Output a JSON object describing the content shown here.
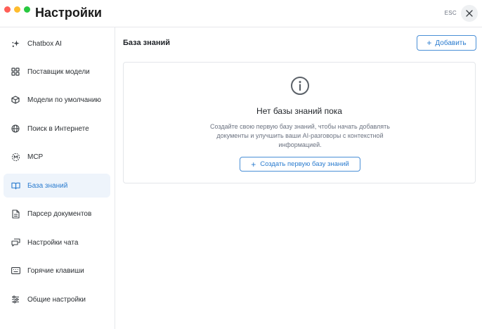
{
  "window": {
    "title": "Настройки",
    "esc_label": "ESC"
  },
  "sidebar": {
    "items": [
      {
        "label": "Chatbox AI",
        "icon": "sparkle-icon",
        "active": false
      },
      {
        "label": "Поставщик модели",
        "icon": "grid-icon",
        "active": false
      },
      {
        "label": "Модели по умолчанию",
        "icon": "cube-icon",
        "active": false
      },
      {
        "label": "Поиск в Интернете",
        "icon": "globe-icon",
        "active": false
      },
      {
        "label": "MCP",
        "icon": "mcp-icon",
        "active": false
      },
      {
        "label": "База знаний",
        "icon": "book-icon",
        "active": true
      },
      {
        "label": "Парсер документов",
        "icon": "document-icon",
        "active": false
      },
      {
        "label": "Настройки чата",
        "icon": "chat-icon",
        "active": false
      },
      {
        "label": "Горячие клавиши",
        "icon": "keyboard-icon",
        "active": false
      },
      {
        "label": "Общие настройки",
        "icon": "sliders-icon",
        "active": false
      }
    ]
  },
  "main": {
    "title": "База знаний",
    "add_label": "Добавить",
    "empty_state": {
      "icon": "info-icon",
      "title": "Нет базы знаний пока",
      "description": "Создайте свою первую базу знаний, чтобы начать добавлять документы и улучшить ваши AI-разговоры с контекстной информацией.",
      "create_label": "Создать первую базу знаний"
    }
  },
  "colors": {
    "accent": "#2b7ccf",
    "active_bg": "#eef4fb",
    "traffic_red": "#ff5f57",
    "traffic_yellow": "#febc2e",
    "traffic_green": "#28c840"
  }
}
